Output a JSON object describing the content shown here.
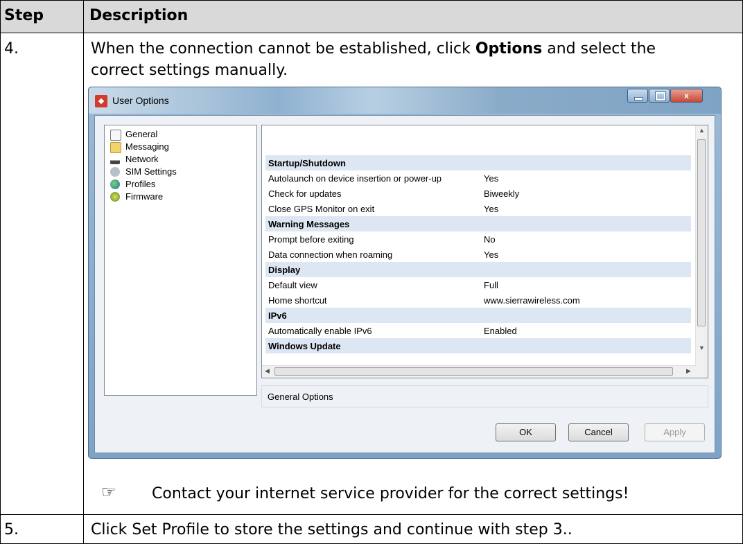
{
  "table": {
    "header_step": "Step",
    "header_description": "Description",
    "row1_step": "4.",
    "row1_line1_pre": "When the connection cannot be established, click ",
    "row1_line1_bold": "Options",
    "row1_line1_post": " and select the",
    "row1_line2": "correct settings manually.",
    "note_icon": "pointing-hand-icon",
    "note": "Contact your internet service provider for the correct settings!",
    "row2_step": "5.",
    "row2_text": "Click Set Profile to store the settings and continue with step 3.."
  },
  "window": {
    "title": "User Options",
    "controls": [
      "minimize-icon",
      "maximize-icon",
      "close-icon"
    ],
    "close_glyph": "x",
    "nav_items": [
      {
        "label": "General",
        "icon": "general-icon"
      },
      {
        "label": "Messaging",
        "icon": "envelope-icon"
      },
      {
        "label": "Network",
        "icon": "network-icon"
      },
      {
        "label": "SIM Settings",
        "icon": "sim-icon"
      },
      {
        "label": "Profiles",
        "icon": "globe-icon"
      },
      {
        "label": "Firmware",
        "icon": "download-icon"
      }
    ],
    "rows": [
      {
        "section": "Startup/Shutdown"
      },
      {
        "key": "Autolaunch on device insertion or power-up",
        "value": "Yes"
      },
      {
        "key": "Check for updates",
        "value": "Biweekly"
      },
      {
        "key": "Close GPS Monitor on exit",
        "value": "Yes"
      },
      {
        "section": "Warning Messages"
      },
      {
        "key": "Prompt before exiting",
        "value": "No"
      },
      {
        "key": "Data connection when roaming",
        "value": "Yes"
      },
      {
        "section": "Display"
      },
      {
        "key": "Default view",
        "value": "Full"
      },
      {
        "key": "Home shortcut",
        "value": "www.sierrawireless.com"
      },
      {
        "section": "IPv6"
      },
      {
        "key": "Automatically enable IPv6",
        "value": "Enabled"
      },
      {
        "section": "Windows Update"
      }
    ],
    "status_text": "General Options",
    "ok": "OK",
    "cancel": "Cancel",
    "apply": "Apply"
  }
}
